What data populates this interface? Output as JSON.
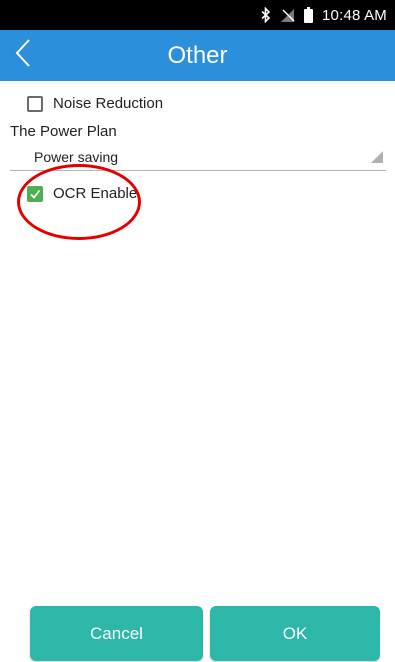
{
  "status_bar": {
    "time": "10:48 AM",
    "icons": [
      "bluetooth-icon",
      "no-signal-icon",
      "battery-icon"
    ]
  },
  "app_bar": {
    "title": "Other",
    "back_icon": "chevron-left-icon"
  },
  "settings": {
    "noise_reduction": {
      "label": "Noise Reduction",
      "checked": false
    },
    "power_plan": {
      "label": "The Power Plan",
      "value": "Power saving"
    },
    "ocr_enable": {
      "label": "OCR Enable",
      "checked": true
    }
  },
  "buttons": {
    "cancel": "Cancel",
    "ok": "OK"
  },
  "colors": {
    "app_bar": "#2c8fdb",
    "button": "#2cb7a8",
    "checkbox_checked": "#4caf50",
    "annotation_circle": "#e30000"
  }
}
